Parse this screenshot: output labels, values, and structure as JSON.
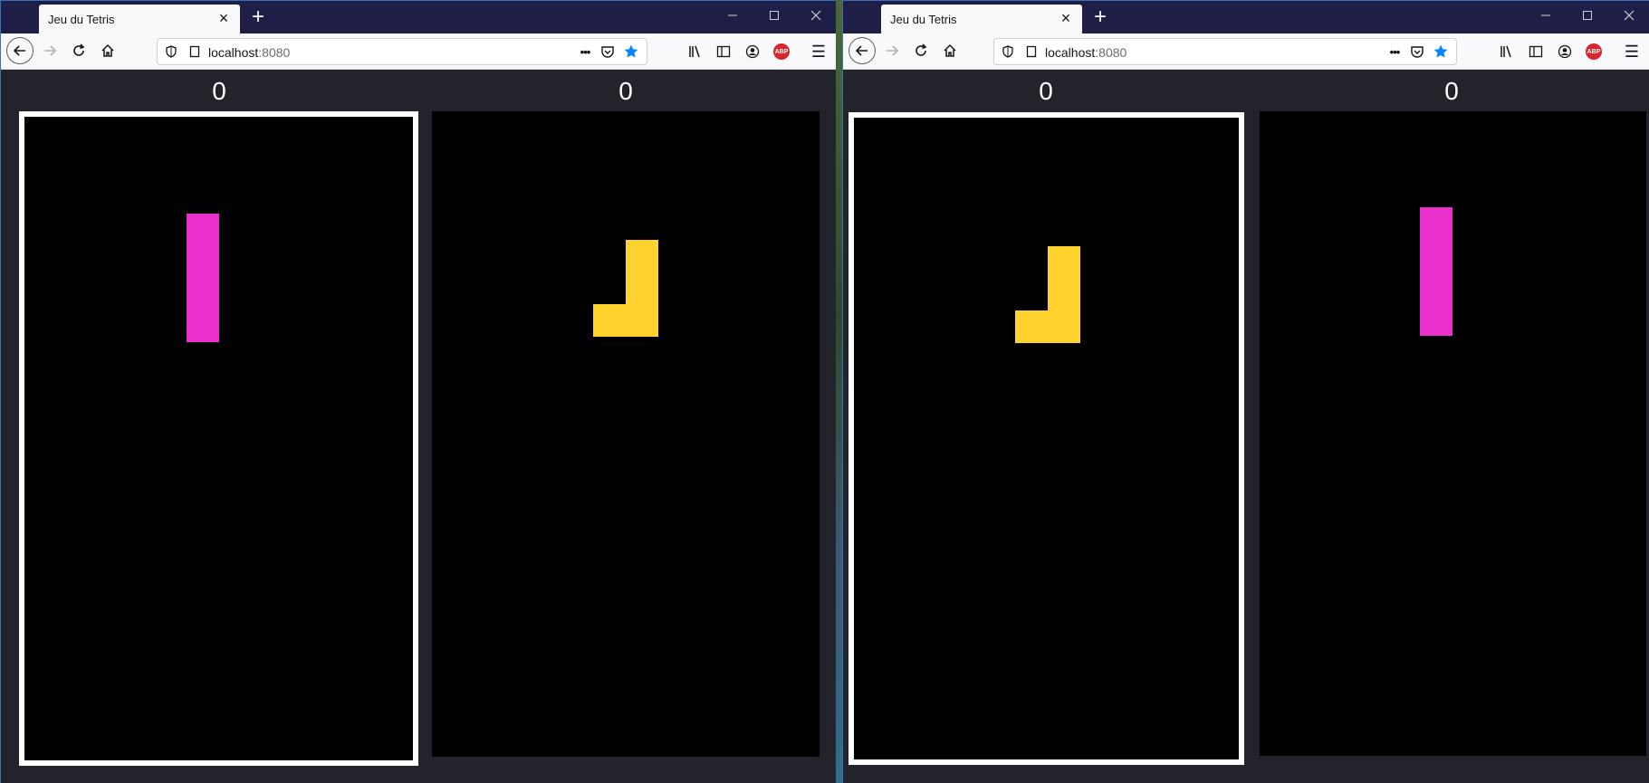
{
  "colors": {
    "titlebar": "#1f1e47",
    "board": "#000000",
    "active_border": "#ffffff",
    "magenta_piece": "#e92fcc",
    "yellow_piece": "#ffd22e"
  },
  "windows": [
    {
      "tab_title": "Jeu du Tetris",
      "url_host": "localhost",
      "url_port": ":8080",
      "boards": [
        {
          "score": "0",
          "active": true,
          "piece": {
            "name": "I",
            "color": "magenta"
          }
        },
        {
          "score": "0",
          "active": false,
          "piece": {
            "name": "J",
            "color": "yellow"
          }
        }
      ]
    },
    {
      "tab_title": "Jeu du Tetris",
      "url_host": "localhost",
      "url_port": ":8080",
      "boards": [
        {
          "score": "0",
          "active": true,
          "piece": {
            "name": "J",
            "color": "yellow"
          }
        },
        {
          "score": "0",
          "active": false,
          "piece": {
            "name": "I",
            "color": "magenta"
          }
        }
      ]
    }
  ],
  "icons": {
    "close_tab": "×",
    "new_tab": "+",
    "minimize": "—",
    "maximize": "☐",
    "close_window": "✕",
    "page_actions": "•••",
    "menu": "☰"
  }
}
